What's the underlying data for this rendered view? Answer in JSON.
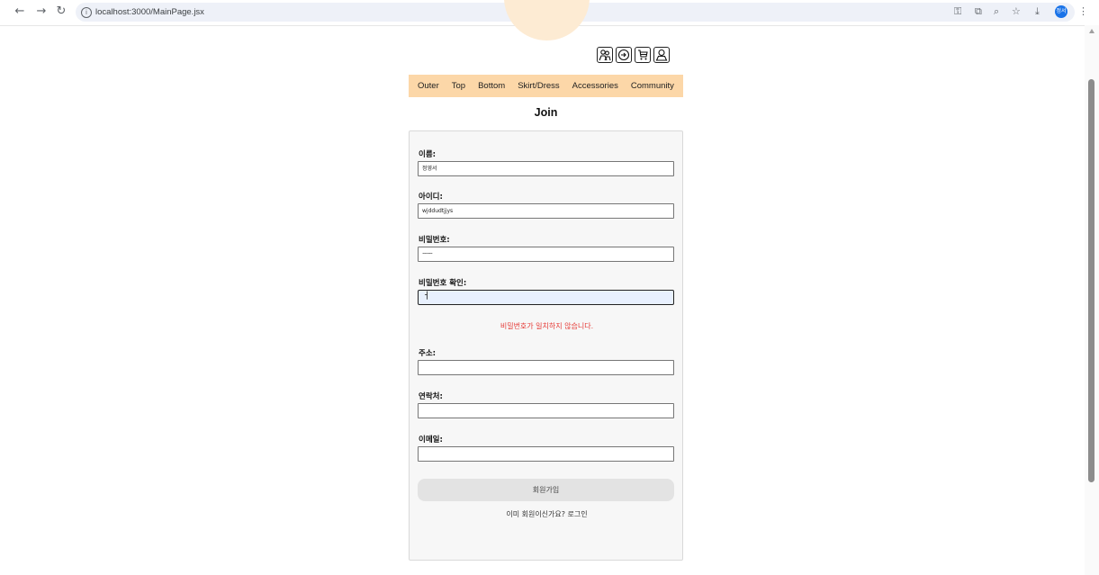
{
  "browser": {
    "url": "localhost:3000/MainPage.jsx"
  },
  "header": {
    "icons": [
      "people-icon",
      "login-icon",
      "cart-icon",
      "user-icon"
    ]
  },
  "nav": {
    "items": [
      "Outer",
      "Top",
      "Bottom",
      "Skirt/Dress",
      "Accessories",
      "Community"
    ]
  },
  "page": {
    "title": "Join"
  },
  "form": {
    "name": {
      "label": "이름:",
      "value": "정영서"
    },
    "id": {
      "label": "아이디:",
      "value": "wjddudtjjys"
    },
    "password": {
      "label": "비밀번호:",
      "value": "············"
    },
    "password_confirm": {
      "label": "비밀번호 확인:",
      "value": "ㅓ"
    },
    "error": "비밀번호가 일치하지 않습니다.",
    "address": {
      "label": "주소:",
      "value": ""
    },
    "phone": {
      "label": "연락처:",
      "value": ""
    },
    "email": {
      "label": "이메일:",
      "value": ""
    },
    "submit_label": "회원가입",
    "login_prompt": "이미 회원이신가요? 로그인"
  },
  "colors": {
    "nav_bg": "#fcd7a8",
    "logo_bg": "#fdebd3",
    "error": "#e53935"
  }
}
